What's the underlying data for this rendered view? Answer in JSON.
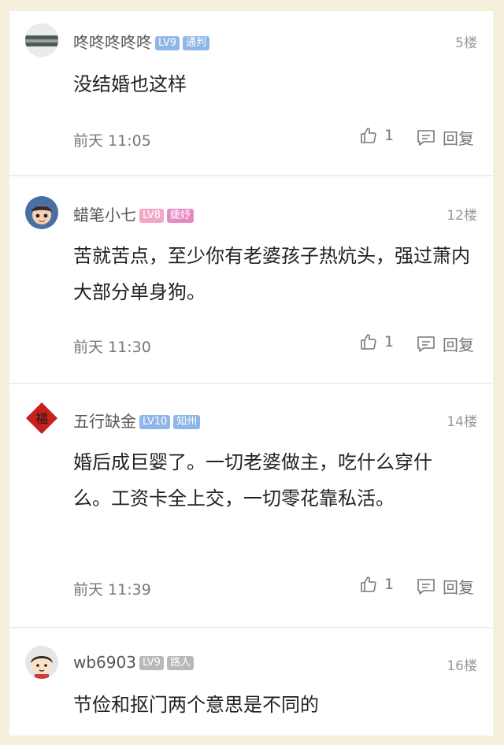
{
  "comments": [
    {
      "username": "咚咚咚咚咚",
      "level": "LV9",
      "title": "通判",
      "floor": "5楼",
      "content": "没结婚也这样",
      "time": "前天 11:05",
      "likes": "1",
      "reply_label": "回复",
      "badge_color": "#8fb6e8",
      "title_color": "#8fb6e8",
      "avatar_icon": "landscape-avatar"
    },
    {
      "username": "蜡笔小七",
      "level": "LV8",
      "title": "婕妤",
      "floor": "12楼",
      "content": "苦就苦点，至少你有老婆孩子热炕头，强过萧内大部分单身狗。",
      "time": "前天 11:30",
      "likes": "1",
      "reply_label": "回复",
      "badge_color": "#f2a7c8",
      "title_color": "#e58ac4",
      "avatar_icon": "cartoon-girl-avatar"
    },
    {
      "username": "五行缺金",
      "level": "LV10",
      "title": "知州",
      "floor": "14楼",
      "content": "婚后成巨婴了。一切老婆做主，吃什么穿什么。工资卡全上交，一切零花靠私活。",
      "time": "前天 11:39",
      "likes": "1",
      "reply_label": "回复",
      "badge_color": "#8fb6e8",
      "title_color": "#8fb6e8",
      "avatar_icon": "fortune-diamond-avatar"
    },
    {
      "username": "wb6903",
      "level": "LV9",
      "title": "路人",
      "floor": "16楼",
      "content": "节俭和抠门两个意思是不同的",
      "time": "",
      "likes": "",
      "reply_label": "",
      "badge_color": "#b9b9b9",
      "title_color": "#b9b9b9",
      "avatar_icon": "cartoon-boy-avatar"
    }
  ]
}
